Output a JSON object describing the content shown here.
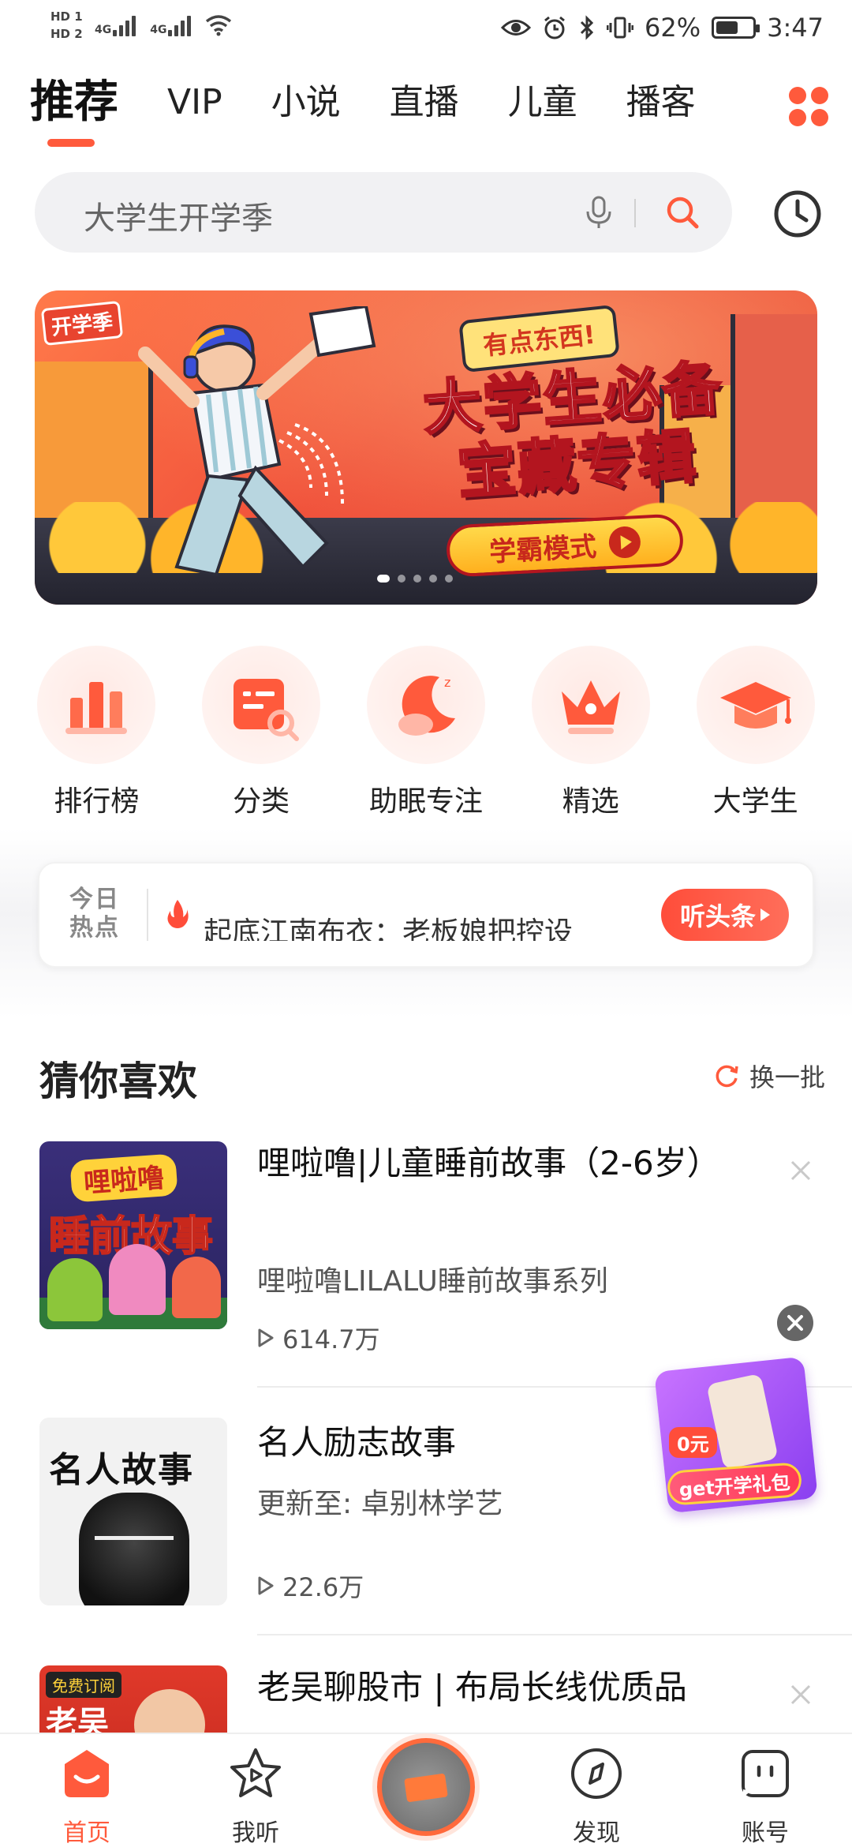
{
  "status_bar": {
    "hd1": "HD 1",
    "hd2": "HD 2",
    "net1": "4G",
    "net2": "4G",
    "battery_percent": "62%",
    "battery_level": 0.62,
    "time": "3:47"
  },
  "tabs": [
    {
      "label": "推荐",
      "active": true
    },
    {
      "label": "VIP"
    },
    {
      "label": "小说"
    },
    {
      "label": "直播"
    },
    {
      "label": "儿童"
    },
    {
      "label": "播客"
    }
  ],
  "search": {
    "placeholder": "大学生开学季"
  },
  "banner": {
    "tag": "开学季",
    "ribbon": "有点东西!",
    "title_line1": "大学生必备",
    "title_line2": "宝藏专辑",
    "button": "学霸模式",
    "page_count": 5,
    "current_page": 1
  },
  "quick_links": [
    {
      "label": "排行榜",
      "icon": "chart-icon"
    },
    {
      "label": "分类",
      "icon": "category-icon"
    },
    {
      "label": "助眠专注",
      "icon": "moon-icon"
    },
    {
      "label": "精选",
      "icon": "crown-icon"
    },
    {
      "label": "大学生",
      "icon": "graduation-cap-icon"
    }
  ],
  "hot_news": {
    "tag_line1": "今日",
    "tag_line2": "热点",
    "text": "起底江南布衣：老板娘把控设",
    "button": "听头条"
  },
  "section": {
    "title": "猜你喜欢",
    "refresh": "换一批"
  },
  "items": [
    {
      "title": "哩啦噜|儿童睡前故事（2-6岁）",
      "subtitle": "哩啦噜LILALU睡前故事系列",
      "plays": "614.7万",
      "cover_caption1": "哩啦噜",
      "cover_caption2": "睡前故事"
    },
    {
      "title": "名人励志故事",
      "subtitle": "更新至: 卓别林学艺",
      "plays": "22.6万",
      "cover_caption": "名人故事"
    },
    {
      "title": "老吴聊股市 | 布局长线优质品",
      "cover_tag": "免费订阅",
      "cover_caption": "老吴"
    }
  ],
  "gift": {
    "zero": "0元",
    "button": "get开学礼包"
  },
  "bottom_nav": [
    {
      "label": "首页",
      "active": true
    },
    {
      "label": "我听"
    },
    {
      "label": "发现"
    },
    {
      "label": "账号"
    }
  ],
  "colors": {
    "accent": "#ff5a3c",
    "text": "#222222",
    "muted": "#555555"
  }
}
